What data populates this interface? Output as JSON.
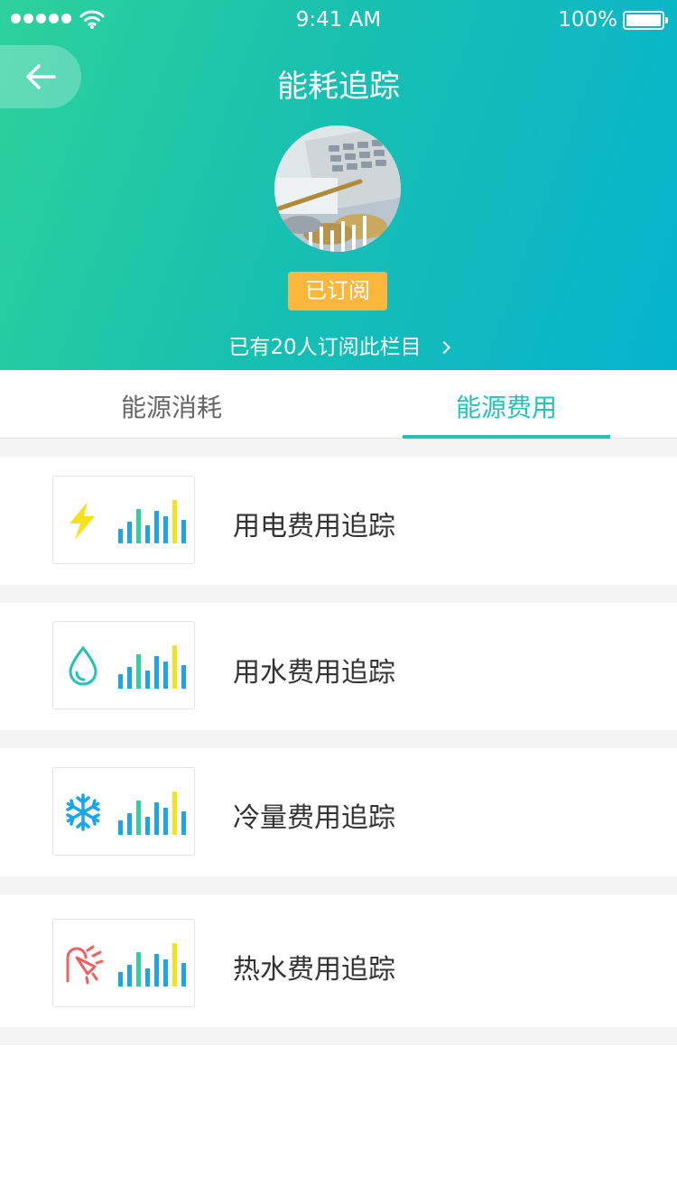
{
  "status_bar": {
    "time": "9:41 AM",
    "battery": "100%"
  },
  "header": {
    "title": "能耗追踪",
    "subscribed_label": "已订阅",
    "subscriber_text": "已有20人订阅此栏目"
  },
  "tabs": [
    {
      "label": "能源消耗",
      "active": false
    },
    {
      "label": "能源费用",
      "active": true
    }
  ],
  "items": [
    {
      "label": "用电费用追踪",
      "icon": "lightning-icon",
      "icon_color": "#f5e11c"
    },
    {
      "label": "用水费用追踪",
      "icon": "water-drop-icon",
      "icon_color": "#22c3b6"
    },
    {
      "label": "冷量费用追踪",
      "icon": "snowflake-icon",
      "icon_color": "#1aa6e8"
    },
    {
      "label": "热水费用追踪",
      "icon": "hot-water-icon",
      "icon_color": "#f06060"
    }
  ],
  "colors": {
    "accent": "#22c3b6",
    "badge": "#fbb73c",
    "bar_blue": "#1aa6e8",
    "bar_green": "#2ed19a",
    "bar_yellow": "#f5e11c"
  }
}
